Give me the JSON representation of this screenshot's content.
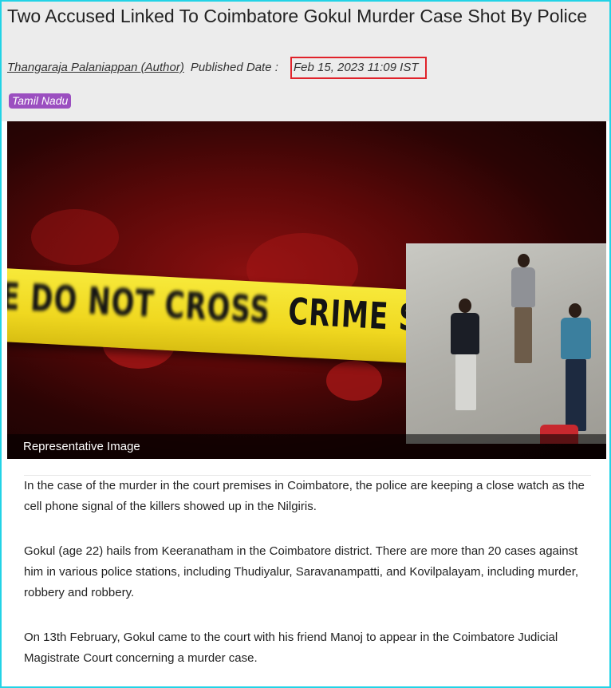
{
  "article": {
    "title": "Two Accused Linked To Coimbatore Gokul Murder Case Shot By Police",
    "author": "Thangaraja Palaniappan (Author)",
    "published_label": "Published Date :",
    "published_date": "Feb 15, 2023 11:09 IST",
    "tag": "Tamil Nadu"
  },
  "hero": {
    "tape_left_text": "NE DO NOT CROSS",
    "tape_right_text": "CRIME SCENE DO",
    "caption": "Representative Image"
  },
  "body": {
    "paragraphs": [
      "In the case of the murder in the court premises in Coimbatore, the police are keeping a close watch as the cell phone signal of the killers showed up in the Nilgiris.",
      "Gokul (age 22) hails from Keeranatham in the Coimbatore district. There are more than 20 cases against him in various police stations, including Thudiyalur, Saravanampatti, and Kovilpalayam, including murder, robbery and robbery.",
      "On 13th February, Gokul came to the court with his friend Manoj to appear in the Coimbatore Judicial Magistrate Court concerning a murder case."
    ]
  },
  "colors": {
    "frame_border": "#22d3e6",
    "highlight_box": "#e0222a",
    "tag_background": "#9b4fc0",
    "header_background": "#ececec"
  }
}
